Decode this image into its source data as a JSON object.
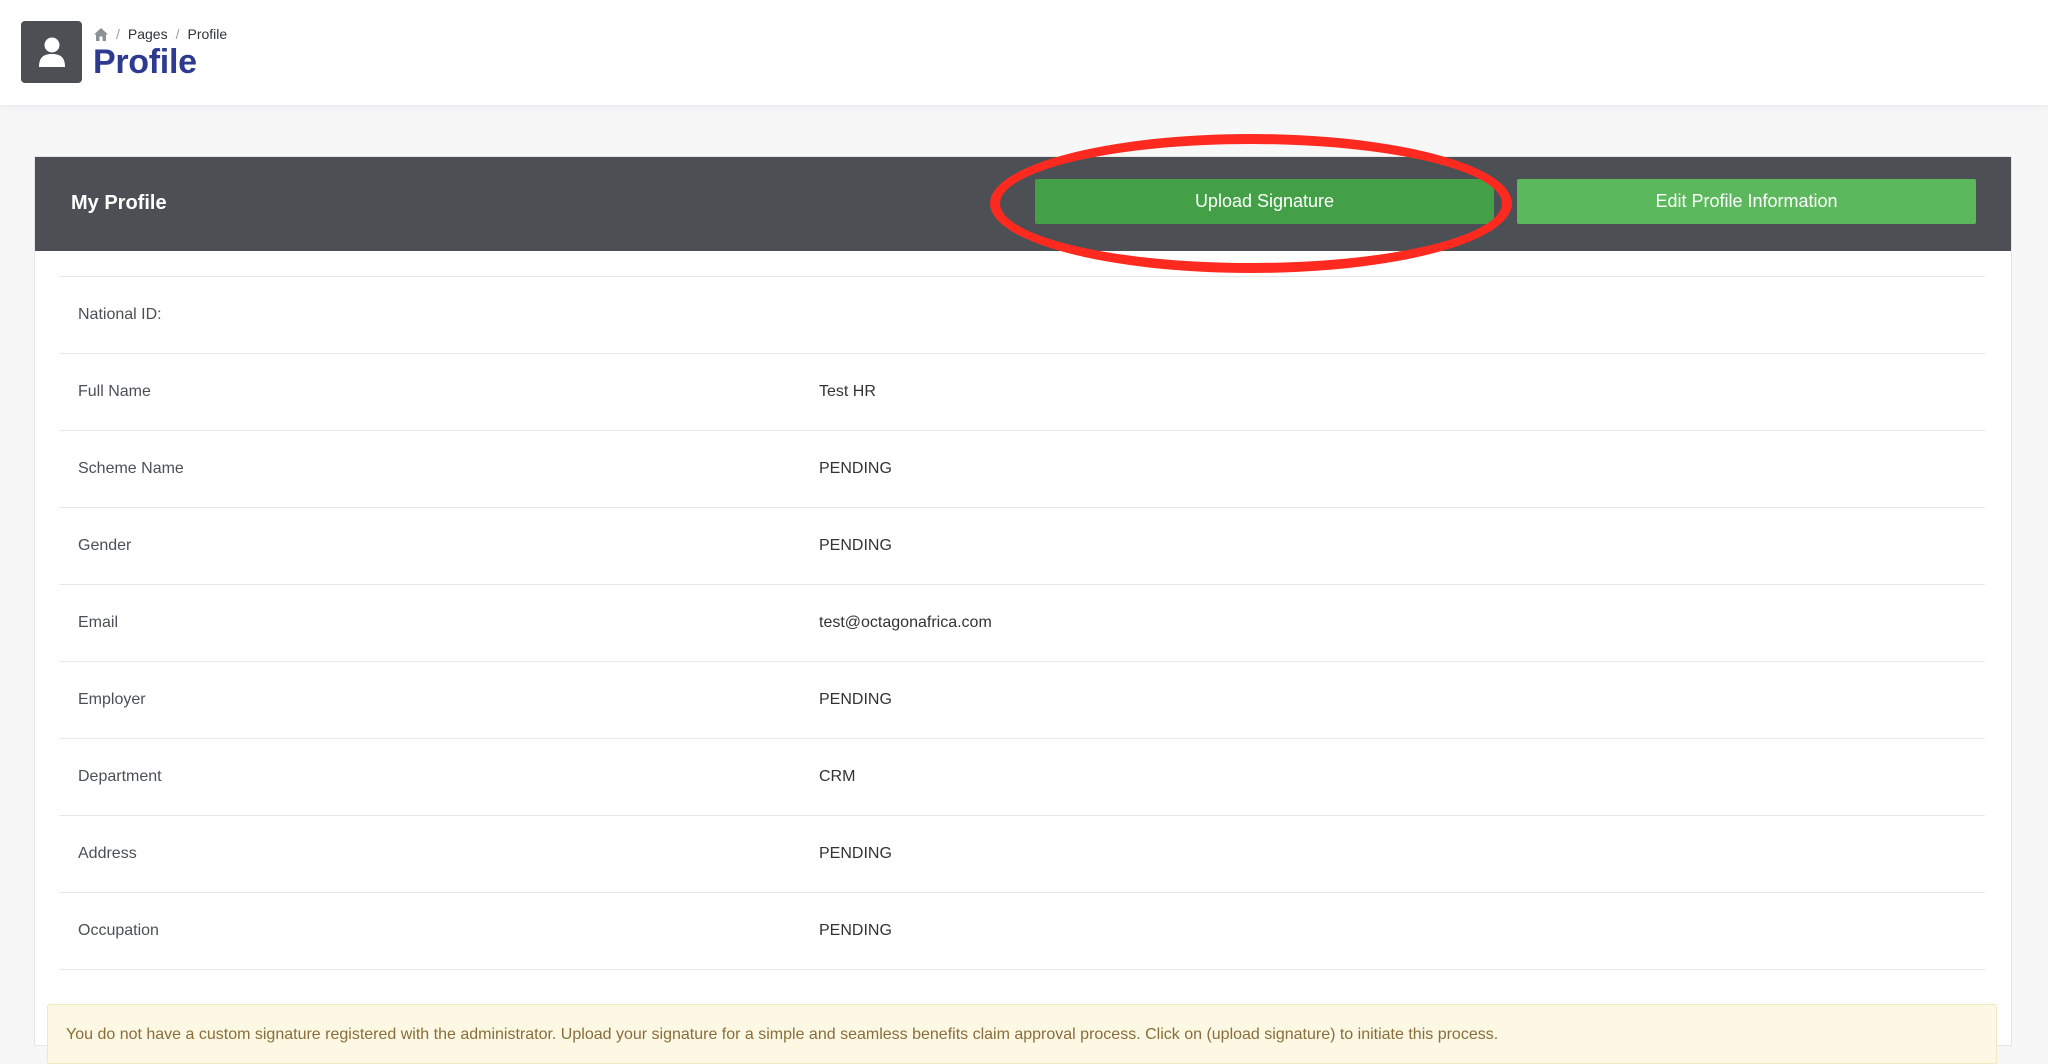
{
  "breadcrumb": {
    "home_icon": "home-icon",
    "items": [
      "Pages",
      "Profile"
    ]
  },
  "page": {
    "title": "Profile",
    "avatar_icon": "user-icon"
  },
  "card": {
    "title": "My Profile",
    "upload_label": "Upload Signature",
    "edit_label": "Edit Profile Information"
  },
  "profile_rows": [
    {
      "label": "National ID:",
      "value": ""
    },
    {
      "label": "Full Name",
      "value": "Test HR"
    },
    {
      "label": "Scheme Name",
      "value": "PENDING"
    },
    {
      "label": "Gender",
      "value": "PENDING"
    },
    {
      "label": "Email",
      "value": "test@octagonafrica.com"
    },
    {
      "label": "Employer",
      "value": "PENDING"
    },
    {
      "label": "Department",
      "value": "CRM"
    },
    {
      "label": "Address",
      "value": "PENDING"
    },
    {
      "label": "Occupation",
      "value": "PENDING"
    }
  ],
  "alert": {
    "text": "You do not have a custom signature registered with the administrator. Upload your signature for a simple and seamless benefits claim approval process. Click on (upload signature) to initiate this process."
  },
  "colors": {
    "header_bg": "#4c5054",
    "title_blue": "#2d3a8f",
    "upload_green": "#43a047",
    "edit_green": "#5cb85c",
    "highlight_red": "#ff2a1f",
    "alert_bg": "#fcf8e3"
  }
}
